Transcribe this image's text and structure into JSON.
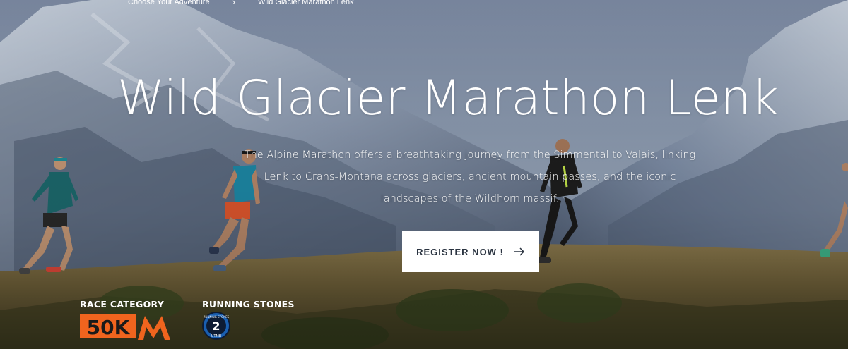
{
  "breadcrumb": {
    "parent": "Choose Your Adventure",
    "separator": "›",
    "current": "Wild Glacier Marathon Lenk"
  },
  "hero": {
    "title": "Wild Glacier Marathon Lenk",
    "description_line1": "The Alpine Marathon offers a breathtaking journey from the Simmental to Valais, linking",
    "description_line2": "Lenk to Crans-Montana across glaciers, ancient mountain passes, and the iconic",
    "description_line3": "landscapes of the Wildhorn massif.",
    "register_label": "REGISTER NOW !",
    "register_icon": "arrow-right-icon"
  },
  "badges": {
    "race_category_label": "RACE CATEGORY",
    "race_category_value": "50K",
    "race_category_icon": "m-logo-icon",
    "running_stones_label": "RUNNING STONES",
    "running_stones_value": "2",
    "running_stones_ring": "RUNNING STONES",
    "running_stones_sub": "UTMB"
  },
  "colors": {
    "accent_orange": "#f0641e",
    "stone_blue": "#1a5fb0",
    "button_text": "#2a3340"
  }
}
